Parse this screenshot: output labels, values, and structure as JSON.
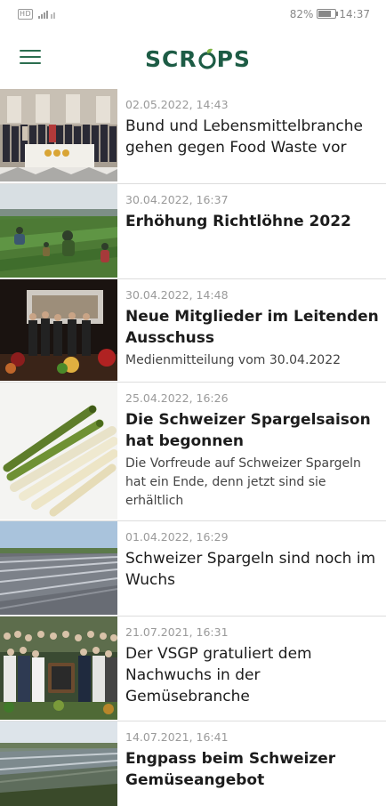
{
  "status": {
    "battery": "82%",
    "time": "14:37",
    "network": "HD 4G"
  },
  "app": {
    "logo": "SCROPS"
  },
  "articles": [
    {
      "date": "02.05.2022, 14:43",
      "title": "Bund und Lebensmittelbranche gehen gegen Food Waste vor",
      "subtitle": ""
    },
    {
      "date": "30.04.2022, 16:37",
      "title": "Erhöhung Richtlöhne 2022",
      "subtitle": ""
    },
    {
      "date": "30.04.2022, 14:48",
      "title": "Neue Mitglieder im Leitenden Ausschuss",
      "subtitle": "Medienmitteilung vom 30.04.2022"
    },
    {
      "date": "25.04.2022, 16:26",
      "title": "Die Schweizer Spargelsaison hat begonnen",
      "subtitle": "Die Vorfreude auf Schweizer Spargeln hat ein Ende, denn jetzt sind sie erhältlich"
    },
    {
      "date": "01.04.2022, 16:29",
      "title": "Schweizer Spargeln sind noch im Wuchs",
      "subtitle": ""
    },
    {
      "date": "21.07.2021, 16:31",
      "title": "Der VSGP gratuliert dem Nachwuchs in der Gemüsebranche",
      "subtitle": ""
    },
    {
      "date": "14.07.2021, 16:41",
      "title": "Engpass beim Schweizer Gemüseangebot",
      "subtitle": ""
    }
  ]
}
